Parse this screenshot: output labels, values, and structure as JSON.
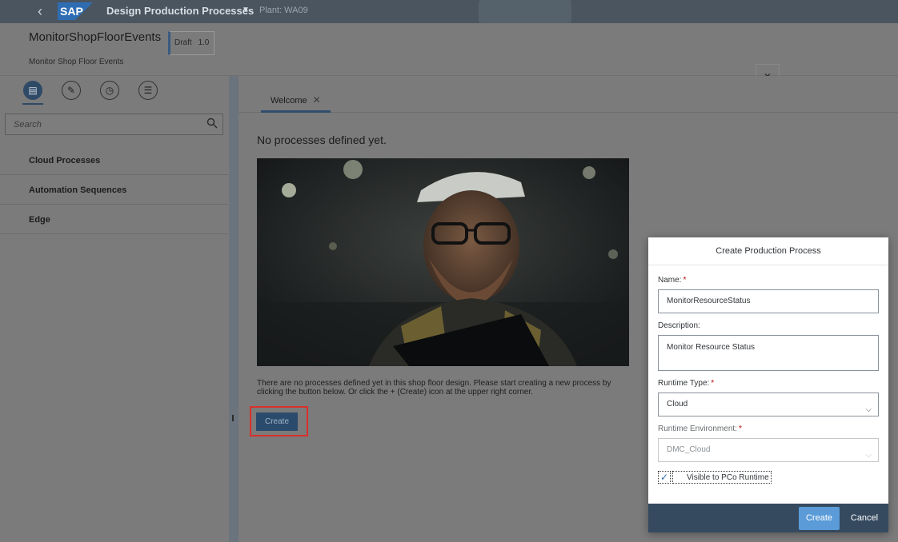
{
  "shell": {
    "back_icon": "chevron-left-icon",
    "logo_text": "SAP",
    "title": "Design Production Processes",
    "plant": "Plant: WA09"
  },
  "header": {
    "object_name": "MonitorShopFloorEvents",
    "status": "Draft",
    "version": "1.0",
    "description": "Monitor Shop Floor Events",
    "collapse_icon": "chevron-down-icon"
  },
  "left_panel": {
    "tools": [
      "process-tree-icon",
      "edit-icon",
      "history-icon",
      "settings-list-icon"
    ],
    "search_placeholder": "Search",
    "categories": [
      "Cloud Processes",
      "Automation Sequences",
      "Edge"
    ]
  },
  "main": {
    "tab": "Welcome",
    "heading": "No processes defined yet.",
    "info_text": "There are no processes defined yet in this shop floor design. Please start creating a new process by clicking the button below. Or click the + (Create) icon at the upper right corner.",
    "create_label": "Create"
  },
  "dialog": {
    "title": "Create Production Process",
    "name_label": "Name:",
    "name_value": "MonitorResourceStatus",
    "description_label": "Description:",
    "description_value": "Monitor Resource Status",
    "runtime_type_label": "Runtime Type:",
    "runtime_type_value": "Cloud",
    "runtime_env_label": "Runtime Environment:",
    "runtime_env_value": "DMC_Cloud",
    "pco_label": "Visible to PCo Runtime",
    "pco_checked": true,
    "required_mark": "*",
    "create_label": "Create",
    "cancel_label": "Cancel"
  },
  "colors": {
    "shell": "#4a5560",
    "accent": "#2b4b6d",
    "emphasized_button": "#5a9bd8",
    "highlight_border": "#d9302b",
    "required": "#bb0000"
  }
}
